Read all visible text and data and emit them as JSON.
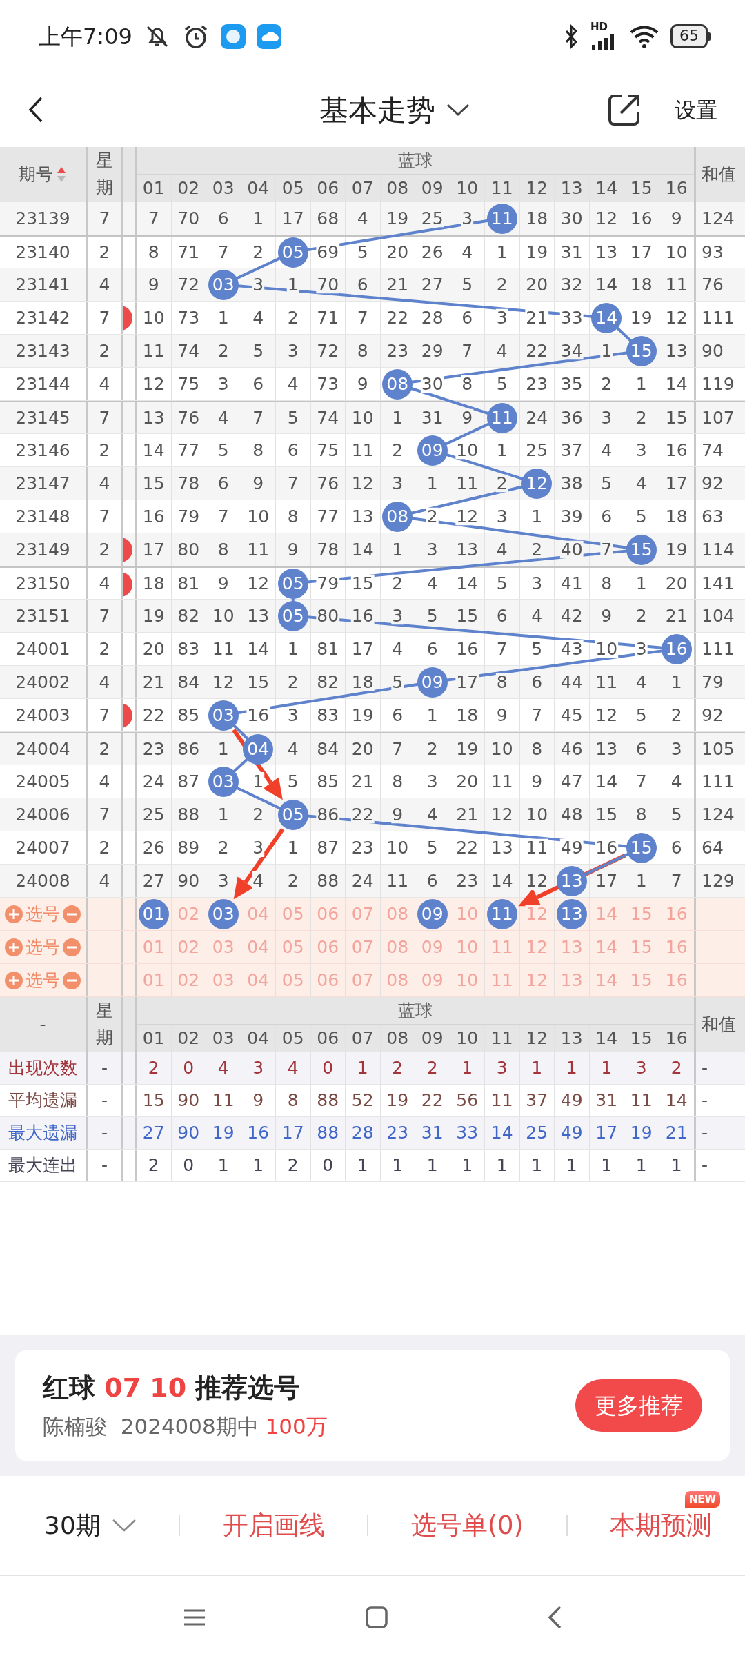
{
  "status_bar": {
    "time": "上午7:09",
    "network": "HD",
    "battery": "65"
  },
  "header": {
    "title": "基本走势",
    "action": "设置"
  },
  "table": {
    "columns": {
      "period": "期号",
      "sort_ascending": true,
      "weekday": "星期",
      "group": "蓝球",
      "numbers": [
        "01",
        "02",
        "03",
        "04",
        "05",
        "06",
        "07",
        "08",
        "09",
        "10",
        "11",
        "12",
        "13",
        "14",
        "15",
        "16"
      ],
      "sum": "和值"
    },
    "rows": [
      {
        "period": "23139",
        "weekday": "7",
        "cut_ball": false,
        "cells": [
          "7",
          "70",
          "6",
          "1",
          "17",
          "68",
          "4",
          "19",
          "25",
          "3",
          {
            "text": "11",
            "ball": true
          },
          "18",
          "30",
          "12",
          "16",
          "9"
        ],
        "sum": "124"
      },
      {
        "period": "23140",
        "weekday": "2",
        "cut_ball": false,
        "cells": [
          "8",
          "71",
          "7",
          "2",
          {
            "text": "05",
            "ball": true
          },
          "69",
          "5",
          "20",
          "26",
          "4",
          "1",
          "19",
          "31",
          "13",
          "17",
          "10"
        ],
        "sum": "93"
      },
      {
        "period": "23141",
        "weekday": "4",
        "cut_ball": false,
        "cells": [
          "9",
          "72",
          {
            "text": "03",
            "ball": true
          },
          "3",
          "1",
          "70",
          "6",
          "21",
          "27",
          "5",
          "2",
          "20",
          "32",
          "14",
          "18",
          "11"
        ],
        "sum": "76"
      },
      {
        "period": "23142",
        "weekday": "7",
        "cut_ball": true,
        "cells": [
          "10",
          "73",
          "1",
          "4",
          "2",
          "71",
          "7",
          "22",
          "28",
          "6",
          "3",
          "21",
          "33",
          {
            "text": "14",
            "ball": true
          },
          "19",
          "12"
        ],
        "sum": "111"
      },
      {
        "period": "23143",
        "weekday": "2",
        "cut_ball": false,
        "cells": [
          "11",
          "74",
          "2",
          "5",
          "3",
          "72",
          "8",
          "23",
          "29",
          "7",
          "4",
          "22",
          "34",
          "1",
          {
            "text": "15",
            "ball": true
          },
          "13"
        ],
        "sum": "90"
      },
      {
        "period": "23144",
        "weekday": "4",
        "cut_ball": false,
        "cells": [
          "12",
          "75",
          "3",
          "6",
          "4",
          "73",
          "9",
          {
            "text": "08",
            "ball": true
          },
          "30",
          "8",
          "5",
          "23",
          "35",
          "2",
          "1",
          "14"
        ],
        "sum": "119"
      },
      {
        "period": "23145",
        "weekday": "7",
        "cut_ball": false,
        "cells": [
          "13",
          "76",
          "4",
          "7",
          "5",
          "74",
          "10",
          "1",
          "31",
          "9",
          {
            "text": "11",
            "ball": true
          },
          "24",
          "36",
          "3",
          "2",
          "15"
        ],
        "sum": "107"
      },
      {
        "period": "23146",
        "weekday": "2",
        "cut_ball": false,
        "cells": [
          "14",
          "77",
          "5",
          "8",
          "6",
          "75",
          "11",
          "2",
          {
            "text": "09",
            "ball": true
          },
          "10",
          "1",
          "25",
          "37",
          "4",
          "3",
          "16"
        ],
        "sum": "74"
      },
      {
        "period": "23147",
        "weekday": "4",
        "cut_ball": false,
        "cells": [
          "15",
          "78",
          "6",
          "9",
          "7",
          "76",
          "12",
          "3",
          "1",
          "11",
          "2",
          {
            "text": "12",
            "ball": true
          },
          "38",
          "5",
          "4",
          "17"
        ],
        "sum": "92"
      },
      {
        "period": "23148",
        "weekday": "7",
        "cut_ball": false,
        "cells": [
          "16",
          "79",
          "7",
          "10",
          "8",
          "77",
          "13",
          {
            "text": "08",
            "ball": true
          },
          "2",
          "12",
          "3",
          "1",
          "39",
          "6",
          "5",
          "18"
        ],
        "sum": "63"
      },
      {
        "period": "23149",
        "weekday": "2",
        "cut_ball": true,
        "cells": [
          "17",
          "80",
          "8",
          "11",
          "9",
          "78",
          "14",
          "1",
          "3",
          "13",
          "4",
          "2",
          "40",
          "7",
          {
            "text": "15",
            "ball": true
          },
          "19"
        ],
        "sum": "114"
      },
      {
        "period": "23150",
        "weekday": "4",
        "cut_ball": true,
        "cells": [
          "18",
          "81",
          "9",
          "12",
          {
            "text": "05",
            "ball": true
          },
          "79",
          "15",
          "2",
          "4",
          "14",
          "5",
          "3",
          "41",
          "8",
          "1",
          "20"
        ],
        "sum": "141"
      },
      {
        "period": "23151",
        "weekday": "7",
        "cut_ball": false,
        "cells": [
          "19",
          "82",
          "10",
          "13",
          {
            "text": "05",
            "ball": true
          },
          "80",
          "16",
          "3",
          "5",
          "15",
          "6",
          "4",
          "42",
          "9",
          "2",
          "21"
        ],
        "sum": "104"
      },
      {
        "period": "24001",
        "weekday": "2",
        "cut_ball": false,
        "cells": [
          "20",
          "83",
          "11",
          "14",
          "1",
          "81",
          "17",
          "4",
          "6",
          "16",
          "7",
          "5",
          "43",
          "10",
          "3",
          {
            "text": "16",
            "ball": true
          }
        ],
        "sum": "111"
      },
      {
        "period": "24002",
        "weekday": "4",
        "cut_ball": false,
        "cells": [
          "21",
          "84",
          "12",
          "15",
          "2",
          "82",
          "18",
          "5",
          {
            "text": "09",
            "ball": true
          },
          "17",
          "8",
          "6",
          "44",
          "11",
          "4",
          "1"
        ],
        "sum": "79"
      },
      {
        "period": "24003",
        "weekday": "7",
        "cut_ball": true,
        "cells": [
          "22",
          "85",
          {
            "text": "03",
            "ball": true
          },
          "16",
          "3",
          "83",
          "19",
          "6",
          "1",
          "18",
          "9",
          "7",
          "45",
          "12",
          "5",
          "2"
        ],
        "sum": "92"
      },
      {
        "period": "24004",
        "weekday": "2",
        "cut_ball": false,
        "cells": [
          "23",
          "86",
          "1",
          {
            "text": "04",
            "ball": true
          },
          "4",
          "84",
          "20",
          "7",
          "2",
          "19",
          "10",
          "8",
          "46",
          "13",
          "6",
          "3"
        ],
        "sum": "105"
      },
      {
        "period": "24005",
        "weekday": "4",
        "cut_ball": false,
        "cells": [
          "24",
          "87",
          {
            "text": "03",
            "ball": true
          },
          "1",
          "5",
          "85",
          "21",
          "8",
          "3",
          "20",
          "11",
          "9",
          "47",
          "14",
          "7",
          "4"
        ],
        "sum": "111"
      },
      {
        "period": "24006",
        "weekday": "7",
        "cut_ball": false,
        "cells": [
          "25",
          "88",
          "1",
          "2",
          {
            "text": "05",
            "ball": true
          },
          "86",
          "22",
          "9",
          "4",
          "21",
          "12",
          "10",
          "48",
          "15",
          "8",
          "5"
        ],
        "sum": "124"
      },
      {
        "period": "24007",
        "weekday": "2",
        "cut_ball": false,
        "cells": [
          "26",
          "89",
          "2",
          "3",
          "1",
          "87",
          "23",
          "10",
          "5",
          "22",
          "13",
          "11",
          "49",
          "16",
          {
            "text": "15",
            "ball": true
          },
          "6"
        ],
        "sum": "64"
      },
      {
        "period": "24008",
        "weekday": "4",
        "cut_ball": false,
        "cells": [
          "27",
          "90",
          "3",
          "4",
          "2",
          "88",
          "24",
          "11",
          "6",
          "23",
          "14",
          "12",
          {
            "text": "13",
            "ball": true
          },
          "17",
          "1",
          "7"
        ],
        "sum": "129"
      }
    ]
  },
  "picks": [
    {
      "label": "选号",
      "numbers": [
        {
          "text": "01",
          "selected": true
        },
        {
          "text": "02",
          "selected": false
        },
        {
          "text": "03",
          "selected": true
        },
        {
          "text": "04",
          "selected": false
        },
        {
          "text": "05",
          "selected": false
        },
        {
          "text": "06",
          "selected": false
        },
        {
          "text": "07",
          "selected": false
        },
        {
          "text": "08",
          "selected": false
        },
        {
          "text": "09",
          "selected": true
        },
        {
          "text": "10",
          "selected": false
        },
        {
          "text": "11",
          "selected": true
        },
        {
          "text": "12",
          "selected": false
        },
        {
          "text": "13",
          "selected": true
        },
        {
          "text": "14",
          "selected": false
        },
        {
          "text": "15",
          "selected": false
        },
        {
          "text": "16",
          "selected": false
        }
      ]
    },
    {
      "label": "选号",
      "numbers": [
        {
          "text": "01",
          "selected": false
        },
        {
          "text": "02",
          "selected": false
        },
        {
          "text": "03",
          "selected": false
        },
        {
          "text": "04",
          "selected": false
        },
        {
          "text": "05",
          "selected": false
        },
        {
          "text": "06",
          "selected": false
        },
        {
          "text": "07",
          "selected": false
        },
        {
          "text": "08",
          "selected": false
        },
        {
          "text": "09",
          "selected": false
        },
        {
          "text": "10",
          "selected": false
        },
        {
          "text": "11",
          "selected": false
        },
        {
          "text": "12",
          "selected": false
        },
        {
          "text": "13",
          "selected": false
        },
        {
          "text": "14",
          "selected": false
        },
        {
          "text": "15",
          "selected": false
        },
        {
          "text": "16",
          "selected": false
        }
      ]
    },
    {
      "label": "选号",
      "numbers": [
        {
          "text": "01",
          "selected": false
        },
        {
          "text": "02",
          "selected": false
        },
        {
          "text": "03",
          "selected": false
        },
        {
          "text": "04",
          "selected": false
        },
        {
          "text": "05",
          "selected": false
        },
        {
          "text": "06",
          "selected": false
        },
        {
          "text": "07",
          "selected": false
        },
        {
          "text": "08",
          "selected": false
        },
        {
          "text": "09",
          "selected": false
        },
        {
          "text": "10",
          "selected": false
        },
        {
          "text": "11",
          "selected": false
        },
        {
          "text": "12",
          "selected": false
        },
        {
          "text": "13",
          "selected": false
        },
        {
          "text": "14",
          "selected": false
        },
        {
          "text": "15",
          "selected": false
        },
        {
          "text": "16",
          "selected": false
        }
      ]
    }
  ],
  "stats": {
    "columns": {
      "period": "-",
      "weekday": "星期",
      "group": "蓝球",
      "numbers": [
        "01",
        "02",
        "03",
        "04",
        "05",
        "06",
        "07",
        "08",
        "09",
        "10",
        "11",
        "12",
        "13",
        "14",
        "15",
        "16"
      ],
      "sum": "和值"
    },
    "rows": [
      {
        "label": "出现次数",
        "color": "#a3343a",
        "weekday": "-",
        "cells": [
          "2",
          "0",
          "4",
          "3",
          "4",
          "0",
          "1",
          "2",
          "2",
          "1",
          "3",
          "1",
          "1",
          "1",
          "3",
          "2"
        ],
        "sum": "-"
      },
      {
        "label": "平均遗漏",
        "color": "#7a4a44",
        "weekday": "-",
        "cells": [
          "15",
          "90",
          "11",
          "9",
          "8",
          "88",
          "52",
          "19",
          "22",
          "56",
          "11",
          "37",
          "49",
          "31",
          "11",
          "14"
        ],
        "sum": "-"
      },
      {
        "label": "最大遗漏",
        "color": "#3f66c8",
        "weekday": "-",
        "cells": [
          "27",
          "90",
          "19",
          "16",
          "17",
          "88",
          "28",
          "23",
          "31",
          "33",
          "14",
          "25",
          "49",
          "17",
          "19",
          "21"
        ],
        "sum": "-"
      },
      {
        "label": "最大连出",
        "color": "#444455",
        "weekday": "-",
        "cells": [
          "2",
          "0",
          "1",
          "1",
          "2",
          "0",
          "1",
          "1",
          "1",
          "1",
          "1",
          "1",
          "1",
          "1",
          "1",
          "1"
        ],
        "sum": "-"
      }
    ]
  },
  "promo": {
    "title": "红球 **07 10** 推荐选号",
    "subtitle": "陈楠骏  2024008期中 **100万**",
    "button": "更多推荐"
  },
  "toolbar": {
    "periods": "30期",
    "items": [
      "开启画线",
      "选号单(0)",
      "本期预测"
    ],
    "badge": "NEW"
  }
}
